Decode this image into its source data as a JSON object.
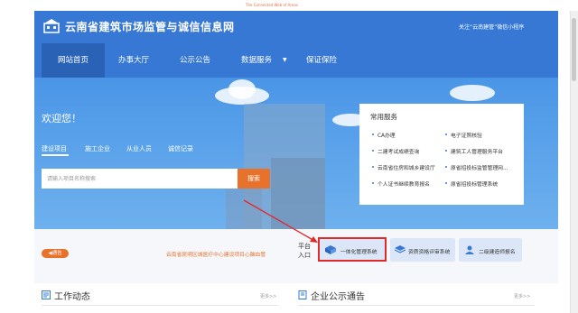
{
  "top_note": "The Connected Web of Areas",
  "header": {
    "title": "云南省建筑市场监管与诚信信息网",
    "right_text": "关注“云南建管”微信小程序"
  },
  "nav": {
    "items": [
      "网站首页",
      "办事大厅",
      "公示公告",
      "数据服务",
      "保证保险"
    ],
    "active": "网站首页"
  },
  "hero": {
    "welcome": "欢迎您！",
    "tabs": [
      "建设项目",
      "施工企业",
      "从业人员",
      "诚信记录"
    ],
    "search_placeholder": "请输入项目名称搜索",
    "search_button": "搜索"
  },
  "services": {
    "title": "常用服务",
    "items": [
      "CA办理",
      "电子证照核验",
      "二建考试成绩查询",
      "建筑工人管理服务平台",
      "云南省住房和城乡建设厅",
      "原省招投标监管管理网...",
      "个人证书继续教育报名",
      "原省招投标管理系统"
    ]
  },
  "notice": {
    "badge": "通告",
    "marquee": "云南省昆明区城医疗中心建设项目心脑血管"
  },
  "platform": {
    "label": "平台入口",
    "cards": [
      "一体化管理系统",
      "资质资格评审系统",
      "二级建造师报名"
    ]
  },
  "sections": [
    {
      "title": "工作动态",
      "more": "更多>>"
    },
    {
      "title": "企业公示通告",
      "more": "更多>>"
    }
  ],
  "colors": {
    "primary": "#3678d4",
    "accent": "#e8722c",
    "highlight": "#e02a2a"
  }
}
